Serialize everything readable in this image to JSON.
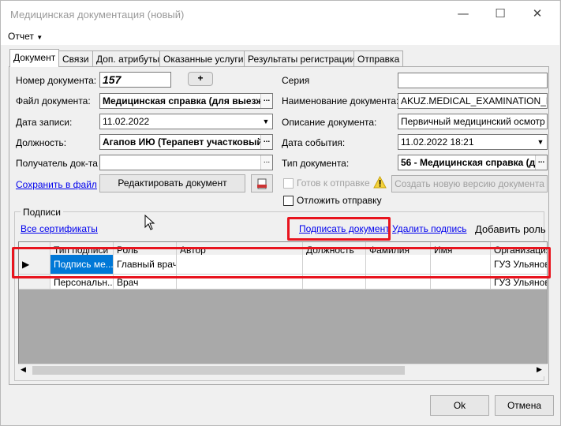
{
  "window": {
    "title": "Медицинская документация (новый)",
    "menu": "Отчет",
    "buttons": {
      "minimize": "—",
      "maximize": "☐",
      "close": "✕"
    }
  },
  "tabs": [
    "Документ",
    "Связи",
    "Доп. атрибуты",
    "Оказанные услуги",
    "Результаты регистрации",
    "Отправка"
  ],
  "left_form": {
    "doc_number_label": "Номер документа:",
    "doc_number_value": "157",
    "plus_button": "+",
    "file_label": "Файл документа:",
    "file_value": "Медицинская справка (для выезж",
    "date_label": "Дата записи:",
    "date_value": "11.02.2022",
    "position_label": "Должность:",
    "position_value": "Агапов ИЮ (Терапевт участковый)",
    "recipient_label": "Получатель док-та",
    "recipient_value": "",
    "save_link": "Сохранить в файл",
    "edit_button": "Редактировать документ"
  },
  "right_form": {
    "series_label": "Серия",
    "series_value": "",
    "name_label": "Наименование документа:",
    "name_value": "AKUZ.MEDICAL_EXAMINATION_MAI",
    "description_label": "Описание документа:",
    "description_value": "Первичный медицинский осмотр",
    "event_date_label": "Дата события:",
    "event_date_value": "11.02.2022 18:21",
    "doc_type_label": "Тип документа:",
    "doc_type_value": "56 - Медицинская справка (д",
    "ready_label": "Готов к отправке",
    "new_version_button": "Создать новую версию документа",
    "postpone_label": "Отложить отправку"
  },
  "signatures": {
    "group_label": "Подписи",
    "all_certs_link": "Все сертификаты",
    "sign_link": "Подписать документ",
    "delete_link": "Удалить подпись",
    "add_role": "Добавить роль",
    "columns": [
      "Тип подписи",
      "Роль",
      "Автор",
      "Должность",
      "Фамилия",
      "Имя",
      "Организация"
    ],
    "rows": [
      [
        "Подпись ме...",
        "Главный врач",
        "",
        "",
        "",
        "",
        "ГУЗ Ульянове"
      ],
      [
        "Персональн...",
        "Врач",
        "",
        "",
        "",
        "",
        "ГУЗ Ульянов"
      ]
    ]
  },
  "footer": {
    "ok": "Ok",
    "cancel": "Отмена"
  },
  "colors": {
    "highlight_red": "#e8141e",
    "selection_blue": "#0078d7",
    "link_blue": "#0000ee"
  }
}
